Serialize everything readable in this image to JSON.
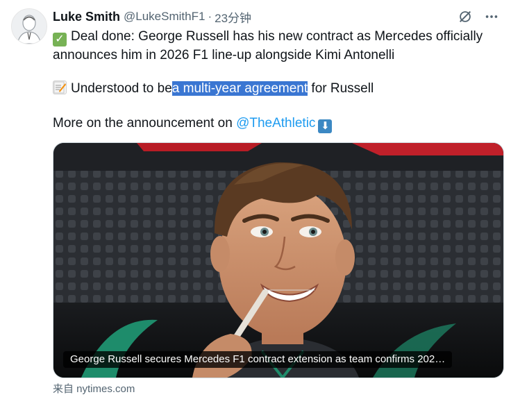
{
  "author": {
    "name": "Luke Smith",
    "handle": "@LukeSmithF1",
    "separator": "·",
    "time": "23分钟"
  },
  "icons": [
    "grok-icon",
    "more-icon",
    "check-mark-emoji",
    "memo-emoji",
    "down-arrow-emoji"
  ],
  "tweet": {
    "line1": "Deal done: George Russell has his new contract as Mercedes officially announces him in 2026 F1 line-up alongside Kimi Antonelli",
    "line2_before": "Understood to be",
    "line2_highlight": "a multi-year agreement",
    "line2_after": " for Russell",
    "line3_before": "More on the announcement on ",
    "line3_mention": "@TheAthletic"
  },
  "card": {
    "caption": "George Russell secures Mercedes F1 contract extension as team confirms 202…",
    "source": "来自 nytimes.com"
  },
  "colors": {
    "mention": "#1d9bf0",
    "selection": "#3a76d2",
    "muted": "#536471"
  }
}
